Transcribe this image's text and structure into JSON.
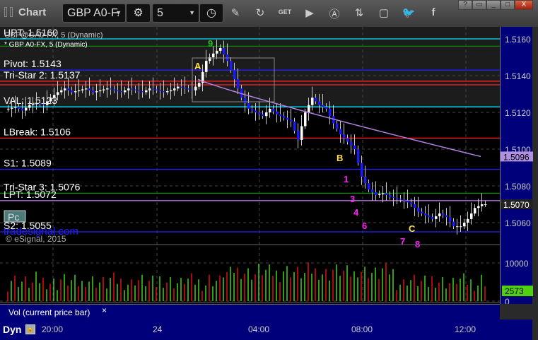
{
  "window": {
    "title": "Chart",
    "symbol": "GBP A0-F.",
    "interval": "5",
    "buttons": [
      "?",
      "▭",
      "_",
      "□",
      "X"
    ]
  },
  "chart_header": {
    "study_overlay": "GBP@GA0-FX, 5 (Dynamic)",
    "symbol_line": "* GBP A0-FX, 5 (Dynamic)",
    "copyright": "© eSignal, 2015",
    "watermark": "tradesignal.com",
    "pc_badge": "Pc"
  },
  "levels": [
    {
      "label": "UPT: 1.5160",
      "price": 1.516,
      "color": "#00e5ff"
    },
    {
      "label": "",
      "price": 1.5156,
      "color": "#008c00"
    },
    {
      "label": "Pivot: 1.5143",
      "price": 1.5143,
      "color": "#2020ff"
    },
    {
      "label": "Tri-Star 2: 1.5137",
      "price": 1.5137,
      "color": "#ff2020"
    },
    {
      "label": "",
      "price": 1.5135,
      "color": "#ff2020"
    },
    {
      "label": "VAL: 1.5123",
      "price": 1.5123,
      "color": "#00e5ff"
    },
    {
      "label": "LBreak: 1.5106",
      "price": 1.5106,
      "color": "#ff2020"
    },
    {
      "label": "S1: 1.5089",
      "price": 1.5089,
      "color": "#2020ff"
    },
    {
      "label": "Tri-Star 3: 1.5076",
      "price": 1.5076,
      "color": "#008c00"
    },
    {
      "label": "LPT: 1.5072",
      "price": 1.5072,
      "color": "#b070e0"
    },
    {
      "label": "S2: 1.5055",
      "price": 1.5055,
      "color": "#2020ff"
    }
  ],
  "chart_data": {
    "type": "candlestick",
    "price_axis": {
      "ticks": [
        "1.5160",
        "1.5140",
        "1.5120",
        "1.5100",
        "1.5080",
        "1.5060"
      ],
      "range": [
        1.505,
        1.517
      ]
    },
    "time_ticks": [
      "20:00",
      "24",
      "04:00",
      "08:00",
      "12:00"
    ],
    "closes": [
      1.5122,
      1.5123,
      1.5121,
      1.5124,
      1.5125,
      1.5124,
      1.5128,
      1.5131,
      1.5133,
      1.5131,
      1.5132,
      1.5133,
      1.5131,
      1.5132,
      1.5133,
      1.5132,
      1.5131,
      1.5133,
      1.5132,
      1.5131,
      1.5133,
      1.5132,
      1.5131,
      1.5132,
      1.5134,
      1.5133,
      1.5132,
      1.5136,
      1.5148,
      1.5152,
      1.5155,
      1.5148,
      1.5138,
      1.5128,
      1.5122,
      1.512,
      1.5118,
      1.5122,
      1.5119,
      1.5117,
      1.5115,
      1.5105,
      1.512,
      1.5128,
      1.5124,
      1.5122,
      1.5114,
      1.5108,
      1.5104,
      1.51,
      1.5085,
      1.5078,
      1.5075,
      1.5076,
      1.5074,
      1.5073,
      1.5072,
      1.507,
      1.5066,
      1.5064,
      1.5062,
      1.5065,
      1.5063,
      1.5058,
      1.5058,
      1.5062,
      1.5068,
      1.507
    ],
    "ma": {
      "color": "#b080e0",
      "last": "1.5096"
    },
    "last_price": "1.5070",
    "volume": {
      "ticks": [
        "10000",
        "0"
      ],
      "last": "2573",
      "label": "Vol (current price bar)"
    },
    "annotations": [
      {
        "text": "A",
        "color": "#ffe040"
      },
      {
        "text": "B",
        "color": "#ffe040"
      },
      {
        "text": "C",
        "color": "#ffe040"
      },
      {
        "text": "1",
        "color": "#ff20ff"
      },
      {
        "text": "3",
        "color": "#ff20ff"
      },
      {
        "text": "4",
        "color": "#ff20ff"
      },
      {
        "text": "6",
        "color": "#ff20ff"
      },
      {
        "text": "7",
        "color": "#ff20ff"
      },
      {
        "text": "8",
        "color": "#ff20ff"
      },
      {
        "text": "9",
        "color": "#20c020"
      }
    ]
  },
  "footer": {
    "mode": "Dyn",
    "close_x": "×"
  }
}
